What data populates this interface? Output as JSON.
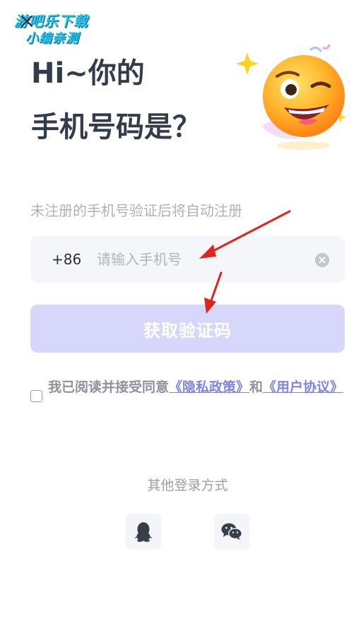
{
  "watermark": {
    "line1": "游吧乐下载",
    "line2": "小编亲测"
  },
  "icons": {
    "close": "close-icon",
    "clear": "clear-icon",
    "qq": "qq-icon",
    "wechat": "wechat-icon",
    "emoji": "winking-face-emoji"
  },
  "header": {
    "title_line1": "Hi~你的",
    "title_line2": "手机号码是？",
    "subtitle": "未注册的手机号验证后将自动注册"
  },
  "phone": {
    "country_code": "+86",
    "value": "",
    "placeholder": "请输入手机号"
  },
  "actions": {
    "get_code_label": "获取验证码"
  },
  "agreement": {
    "checked": false,
    "prefix": "我已阅读并接受同意",
    "privacy_link": "《隐私政策》",
    "conjunction": "和",
    "user_link": "《用户协议》"
  },
  "other_login": {
    "label": "其他登录方式"
  },
  "colors": {
    "title": "#333d4a",
    "subtitle": "#aeb2bb",
    "input_bg": "#f5f6f9",
    "button_disabled": "#d7d7fb",
    "link": "#7f83ec",
    "annotation_arrow": "#e0241f"
  }
}
